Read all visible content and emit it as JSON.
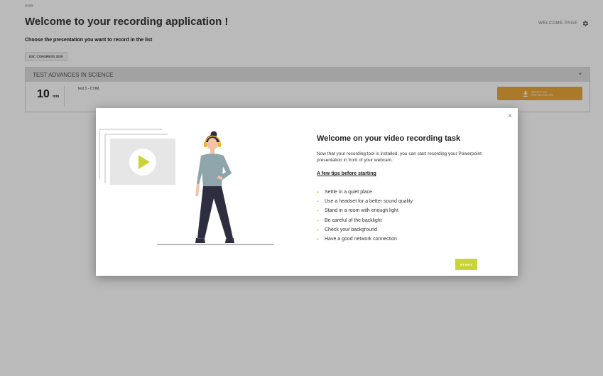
{
  "header": {
    "hub_label": "HUB",
    "title": "Welcome to your recording application !",
    "welcome_page_link": "WELCOME PAGE",
    "settings_icon": "gear-icon"
  },
  "main": {
    "subtitle": "Choose the presentation you want to record in the list",
    "event_chip": "ESC CONGRESS 2020",
    "session": {
      "title": "TEST ADVANCES IN SCIENCE",
      "presentation": {
        "duration": "10",
        "duration_unit": "min",
        "title": "test 3 - CYIM.",
        "select_button": "SELECT MY PRESENTATION"
      }
    }
  },
  "modal": {
    "title": "Welcome on your video recording task",
    "intro": "Now that your recording tool is installed, you can start recording your Powerpoint presentation in front of your webcam.",
    "tips_heading": "A few tips before starting",
    "tips": [
      "Settle in a quiet place",
      "Use a headset for a better sound quality",
      "Stand in a room with enough light",
      "Be careful of the backlight",
      "Check your background",
      "Have a good network connection"
    ],
    "start_button": "START",
    "close_symbol": "×"
  },
  "colors": {
    "accent_green": "#c9d436",
    "select_orange": "#e9a83a",
    "session_header_bg": "#dedede",
    "headset_yellow": "#f0b429",
    "illustration_shirt": "#8fa5ac",
    "illustration_pants": "#2f2e41"
  }
}
